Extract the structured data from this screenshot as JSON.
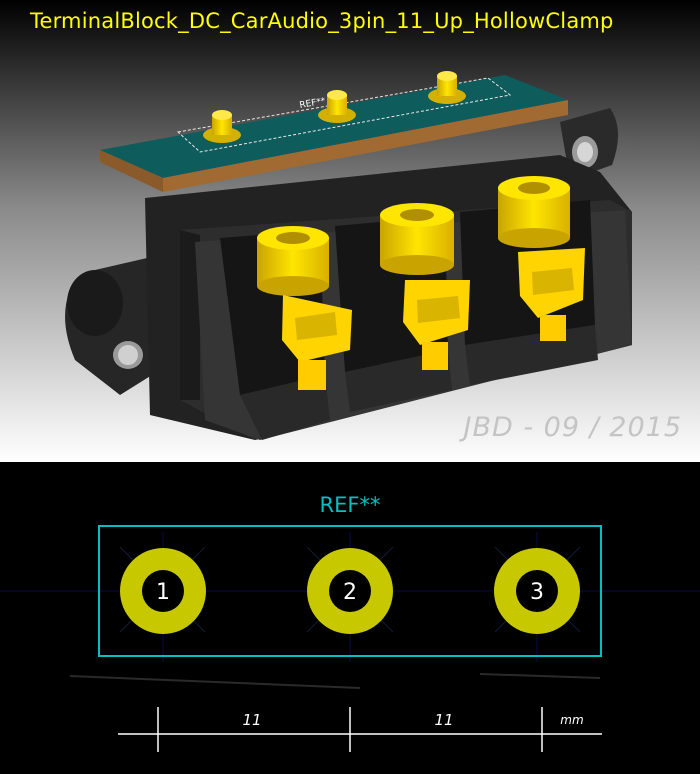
{
  "title": "TerminalBlock_DC_CarAudio_3pin_11_Up_HollowClamp",
  "signature": "JBD - 09 / 2015",
  "render": {
    "board_ref_label": "REF**"
  },
  "footprint": {
    "ref_label": "REF**",
    "pads": [
      {
        "number": "1"
      },
      {
        "number": "2"
      },
      {
        "number": "3"
      }
    ],
    "dimensions": {
      "spacings": [
        "11",
        "11"
      ],
      "unit": "mm"
    }
  },
  "colors": {
    "title": "#ffff00",
    "silkscreen": "#00c0c0",
    "pad": "#c8c800",
    "pin_gold": "#ffd400",
    "board": "#0e5a5a",
    "housing": "#1e1e1e"
  }
}
